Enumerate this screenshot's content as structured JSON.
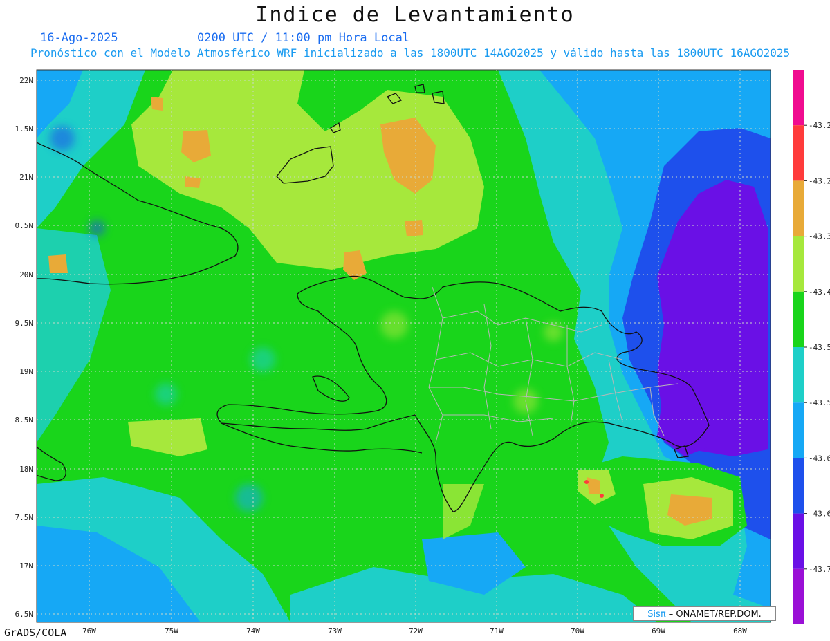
{
  "title": "Indice de Levantamiento",
  "date": "16-Ago-2025",
  "time": "0200 UTC / 11:00 pm Hora Local",
  "subtitle": "Pronóstico con el Modelo Atmosférico WRF inicializado a las 1800UTC_14AGO2025 y válido hasta las  1800UTC_16AGO2025",
  "footer_left": "GrADS/COLA",
  "credit": {
    "brand": "Sisπ",
    "rest": " – ONAMET/REP.DOM."
  },
  "map": {
    "lat_labels": [
      "22N",
      "1.5N",
      "21N",
      "0.5N",
      "20N",
      "9.5N",
      "19N",
      "8.5N",
      "18N",
      "7.5N",
      "17N",
      "6.5N"
    ],
    "lon_labels": [
      "76W",
      "75W",
      "74W",
      "73W",
      "72W",
      "71W",
      "70W",
      "69W",
      "68W"
    ]
  },
  "colorbar": {
    "colors": [
      "#f00c90",
      "#ff3b3b",
      "#e8aa38",
      "#a6e83c",
      "#19d51b",
      "#1ecfc8",
      "#16a8f5",
      "#1e50ec",
      "#6a10e6",
      "#9a10d6"
    ],
    "labels": [
      "-43.2",
      "-43.2",
      "-43.3",
      "-43.4",
      "-43.5",
      "-43.5",
      "-43.6",
      "-43.6",
      "-43.7"
    ]
  },
  "palette": {
    "green": "#19d51b",
    "lightgreen": "#a6e83c",
    "orange": "#e8aa38",
    "cyan": "#1ecfc8",
    "sky": "#16a8f5",
    "blue": "#1e50ec",
    "violet": "#6a10e6",
    "red": "#ff3b3b"
  }
}
